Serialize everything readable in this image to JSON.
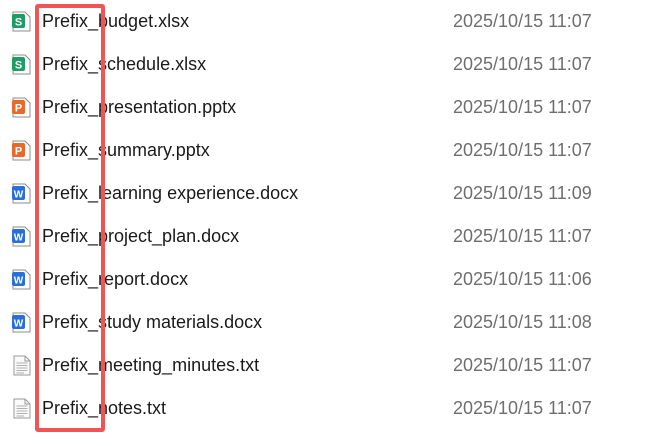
{
  "highlight_color": "#f05454",
  "icon_colors": {
    "spreadsheet": "#1e9e64",
    "presentation": "#e8692a",
    "document": "#2b6fd6",
    "text": "#bdbdbd"
  },
  "files": [
    {
      "name": "Prefix_budget.xlsx",
      "modified": "2025/10/15 11:07",
      "icon": "spreadsheet-icon",
      "icon_letter": "S"
    },
    {
      "name": "Prefix_schedule.xlsx",
      "modified": "2025/10/15 11:07",
      "icon": "spreadsheet-icon",
      "icon_letter": "S"
    },
    {
      "name": "Prefix_presentation.pptx",
      "modified": "2025/10/15 11:07",
      "icon": "presentation-icon",
      "icon_letter": "P"
    },
    {
      "name": "Prefix_summary.pptx",
      "modified": "2025/10/15 11:07",
      "icon": "presentation-icon",
      "icon_letter": "P"
    },
    {
      "name": "Prefix_learning experience.docx",
      "modified": "2025/10/15 11:09",
      "icon": "document-icon",
      "icon_letter": "W"
    },
    {
      "name": "Prefix_project_plan.docx",
      "modified": "2025/10/15 11:07",
      "icon": "document-icon",
      "icon_letter": "W"
    },
    {
      "name": "Prefix_report.docx",
      "modified": "2025/10/15 11:06",
      "icon": "document-icon",
      "icon_letter": "W"
    },
    {
      "name": "Prefix_study materials.docx",
      "modified": "2025/10/15 11:08",
      "icon": "document-icon",
      "icon_letter": "W"
    },
    {
      "name": "Prefix_meeting_minutes.txt",
      "modified": "2025/10/15 11:07",
      "icon": "text-file-icon",
      "icon_letter": ""
    },
    {
      "name": "Prefix_notes.txt",
      "modified": "2025/10/15 11:07",
      "icon": "text-file-icon",
      "icon_letter": ""
    }
  ]
}
